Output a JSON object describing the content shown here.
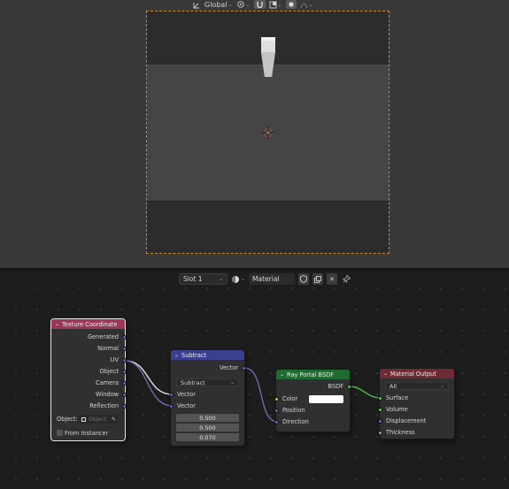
{
  "viewport": {
    "header": {
      "orientation_label": "Global"
    }
  },
  "node_editor": {
    "header": {
      "slot_label": "Slot 1",
      "material_name": "Material"
    },
    "nodes": {
      "texture_coordinate": {
        "title": "Texture Coordinate",
        "header_color": "#983a57",
        "outputs": [
          "Generated",
          "Normal",
          "UV",
          "Object",
          "Camera",
          "Window",
          "Reflection"
        ],
        "object_label": "Object:",
        "object_placeholder": "Object",
        "from_instancer_label": "From Instancer"
      },
      "subtract": {
        "title": "Subtract",
        "header_color": "#3b3f8f",
        "output": "Vector",
        "operation": "Subtract",
        "inputs": [
          "Vector",
          "Vector"
        ],
        "values": [
          "0.500",
          "0.500",
          "0.070"
        ]
      },
      "ray_portal": {
        "title": "Ray Portal BSDF",
        "header_color": "#1f6b32",
        "output": "BSDF",
        "inputs": [
          "Color",
          "Position",
          "Direction"
        ],
        "color_value": "#ffffff"
      },
      "material_output": {
        "title": "Material Output",
        "header_color": "#702a33",
        "target": "All",
        "inputs": [
          "Surface",
          "Volume",
          "Displacement",
          "Thickness"
        ]
      }
    },
    "socket_colors": {
      "vector": "#6363c7",
      "color": "#c7c729",
      "shader": "#63c763",
      "float": "#a1a1a1"
    }
  }
}
